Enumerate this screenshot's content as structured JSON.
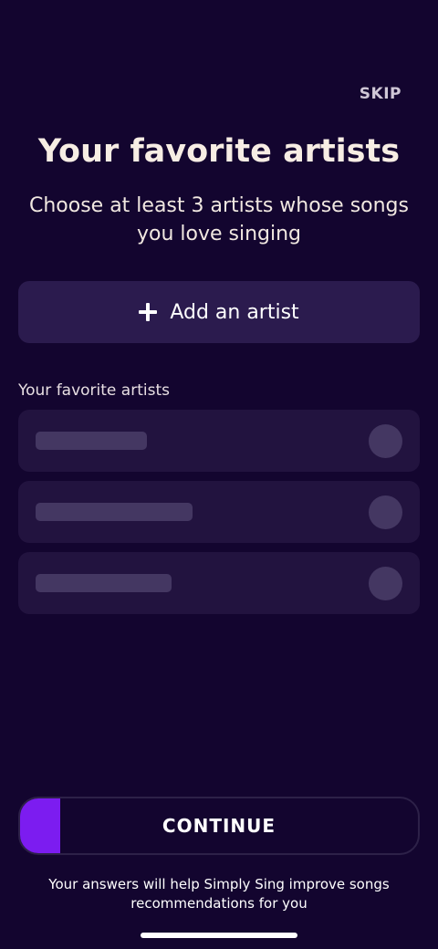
{
  "header": {
    "skip_label": "SKIP"
  },
  "main": {
    "title": "Your favorite artists",
    "subtitle": "Choose at least 3 artists whose songs you love singing",
    "add_artist_label": "Add an artist",
    "add_artist_icon": "plus-icon",
    "section_label": "Your favorite artists",
    "artist_slots": [
      {
        "state": "placeholder"
      },
      {
        "state": "placeholder"
      },
      {
        "state": "placeholder"
      }
    ]
  },
  "footer": {
    "continue_label": "CONTINUE",
    "progress": 0.1,
    "note": "Your answers will help Simply Sing improve songs recommendations for you"
  },
  "colors": {
    "background": "#13052f",
    "card": "#2b1b4e",
    "slot": "#22133f",
    "skeleton": "#443762",
    "accent": "#7c1cf0"
  }
}
